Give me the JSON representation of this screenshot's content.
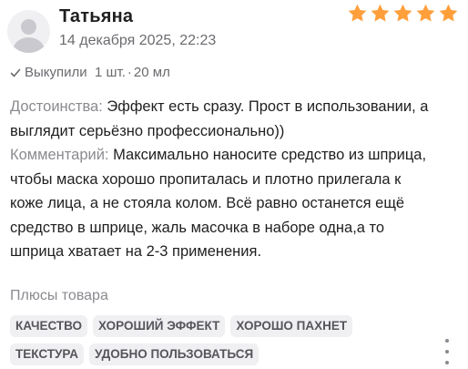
{
  "review": {
    "author": "Татьяна",
    "date": "14 декабря 2025, 22:23",
    "rating": 5,
    "star_color": "#ff9f3b",
    "purchase": {
      "status": "Выкупили",
      "quantity": "1 шт.",
      "separator": "·",
      "volume": "20 мл"
    },
    "advantages_label": "Достоинства:",
    "advantages_text": "Эффект есть сразу. Прост в использовании, а выглядит серьёзно профессионально))",
    "comment_label": "Комментарий:",
    "comment_text": "Максимально наносите средство из шприца, чтобы маска хорошо пропиталась и плотно прилегала к коже лица, а не стояла колом. Всё равно останется ещё средство в шприце, жаль масочка в наборе одна,а то шприца хватает на 2-3 применения.",
    "pros_title": "Плюсы товара",
    "tags": [
      "КАЧЕСТВО",
      "ХОРОШИЙ ЭФФЕКТ",
      "ХОРОШО ПАХНЕТ",
      "ТЕКСТУРА",
      "УДОБНО ПОЛЬЗОВАТЬСЯ"
    ]
  },
  "icons": {
    "avatar": "user-avatar-placeholder",
    "check": "checkmark-icon",
    "more": "more-vertical-icon"
  }
}
